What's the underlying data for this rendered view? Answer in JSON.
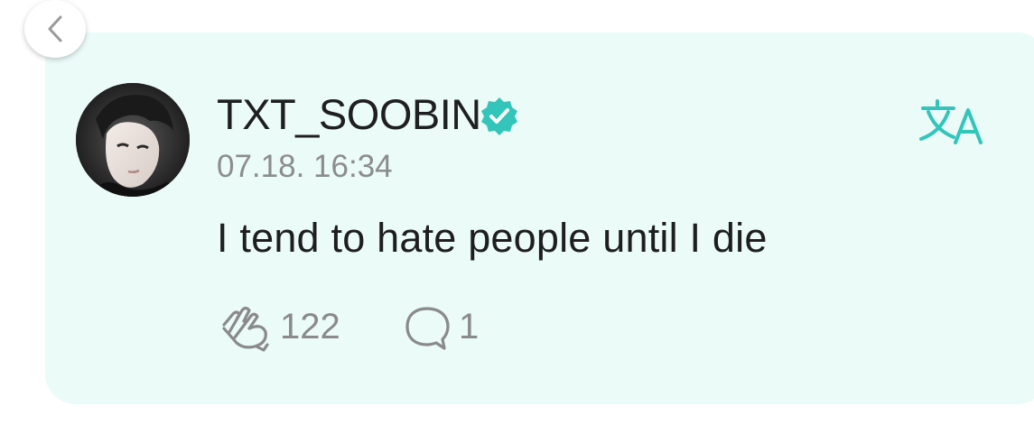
{
  "nav": {
    "back_icon": "chevron-left-icon"
  },
  "post": {
    "username": "TXT_SOOBIN",
    "verified_icon": "verified-badge-icon",
    "timestamp": "07.18. 16:34",
    "text": "I tend to hate people until I die",
    "translate_icon": "translate-icon",
    "likes": {
      "icon": "cheer-hand-icon",
      "count": "122"
    },
    "comments": {
      "icon": "comment-bubble-icon",
      "count": "1"
    }
  },
  "colors": {
    "card_background": "#eafbf8",
    "accent": "#33c5b9",
    "username": "#1f1f1f",
    "meta": "#8c8c8c"
  }
}
